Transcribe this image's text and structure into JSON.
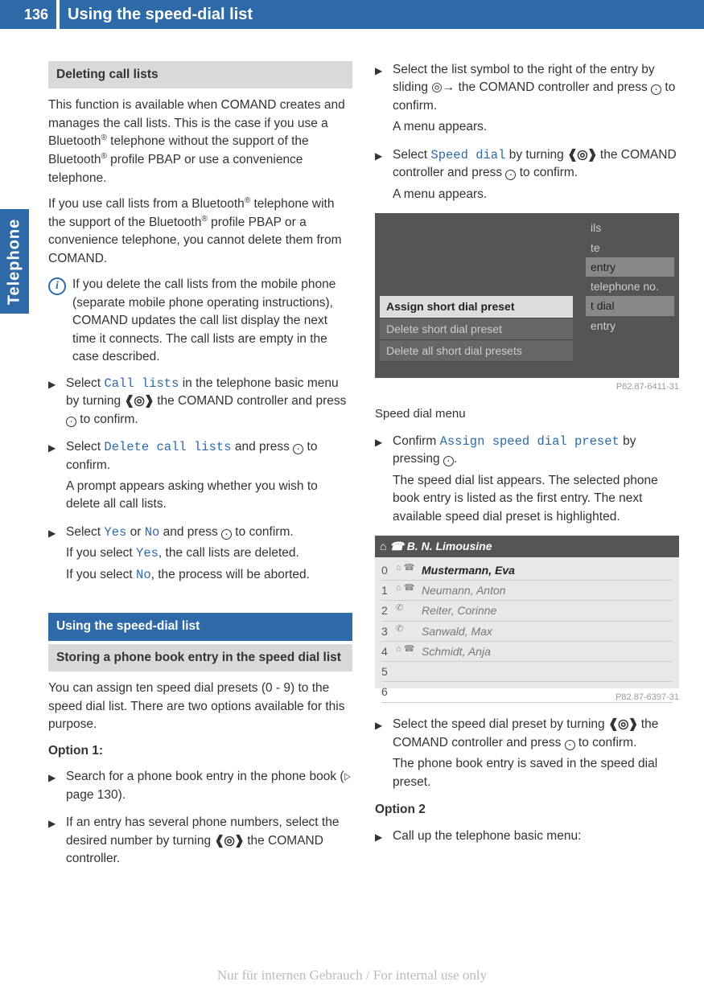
{
  "header": {
    "page_num": "136",
    "title": "Using the speed-dial list"
  },
  "side_tab": "Telephone",
  "left": {
    "h_del": "Deleting call lists",
    "p1a": "This function is available when COMAND creates and manages the call lists. This is the case if you use a Bluetooth",
    "p1b": " telephone without the support of the Bluetooth",
    "p1c": " profile PBAP or use a convenience telephone.",
    "p2a": "If you use call lists from a Bluetooth",
    "p2b": " telephone with the support of the Bluetooth",
    "p2c": " profile PBAP or a convenience telephone, you cannot delete them from COMAND.",
    "info": "If you delete the call lists from the mobile phone (separate mobile phone operating instructions), COMAND updates the call list display the next time it connects. The call lists are empty in the case described.",
    "s1a": "Select ",
    "s1_menu": "Call lists",
    "s1b": " in the telephone basic menu by turning ",
    "s1c": " the COMAND controller and press ",
    "s1d": " to confirm.",
    "s2a": "Select ",
    "s2_menu": "Delete call lists",
    "s2b": " and press ",
    "s2c": " to confirm.",
    "s2d": "A prompt appears asking whether you wish to delete all call lists.",
    "s3a": "Select ",
    "s3_yes": "Yes",
    "s3_or": " or ",
    "s3_no": "No",
    "s3b": " and press ",
    "s3c": " to confirm.",
    "s3d1": "If you select ",
    "s3d2": ", the call lists are deleted.",
    "s3e1": "If you select ",
    "s3e2": ", the process will be aborted.",
    "h_use": "Using the speed-dial list",
    "h_store": "Storing a phone book entry in the speed dial list",
    "p3": "You can assign ten speed dial presets (0 - 9) to the speed dial list. There are two options available for this purpose.",
    "opt1": "Option 1:",
    "s4a": "Search for a phone book entry in the phone book (",
    "s4_page": " page 130).",
    "s5a": "If an entry has several phone numbers, select the desired number by turning ",
    "s5b": " the COMAND controller."
  },
  "right": {
    "s6a": "Select the list symbol to the right of the entry by sliding ",
    "s6b": " the COMAND controller and press ",
    "s6c": " to confirm.",
    "s6d": "A menu appears.",
    "s7a": "Select ",
    "s7_menu": "Speed dial",
    "s7b": " by turning ",
    "s7c": " the COMAND controller and press ",
    "s7d": " to confirm.",
    "s7e": "A menu appears.",
    "sc1": {
      "r1": "ils",
      "r2": "te",
      "r3": "entry",
      "r4": "telephone no.",
      "r5": "t dial",
      "r6": "entry",
      "m1": "Assign short dial preset",
      "m2": "Delete short dial preset",
      "m3": "Delete all short dial presets"
    },
    "img1_id": "P82.87-6411-31",
    "cap1": "Speed dial menu",
    "s8a": "Confirm ",
    "s8_menu": "Assign speed dial preset",
    "s8b": " by pressing ",
    "s8c": ".",
    "s8d": "The speed dial list appears. The selected phone book entry is listed as the first entry. The next available speed dial preset is highlighted.",
    "sc2": {
      "hdr": "B. N. Limousine",
      "rows": [
        {
          "n": "0",
          "nm": "Mustermann, Eva"
        },
        {
          "n": "1",
          "nm": "Neumann, Anton"
        },
        {
          "n": "2",
          "nm": "Reiter, Corinne"
        },
        {
          "n": "3",
          "nm": "Sanwald, Max"
        },
        {
          "n": "4",
          "nm": "Schmidt, Anja"
        },
        {
          "n": "5",
          "nm": ""
        },
        {
          "n": "6",
          "nm": ""
        }
      ]
    },
    "img2_id": "P82.87-6397-31",
    "s9a": "Select the speed dial preset by turning ",
    "s9b": " the COMAND controller and press ",
    "s9c": " to confirm.",
    "s9d": "The phone book entry is saved in the speed dial preset.",
    "opt2": "Option 2",
    "s10": "Call up the telephone basic menu:"
  },
  "footer": "Nur für internen Gebrauch / For internal use only"
}
